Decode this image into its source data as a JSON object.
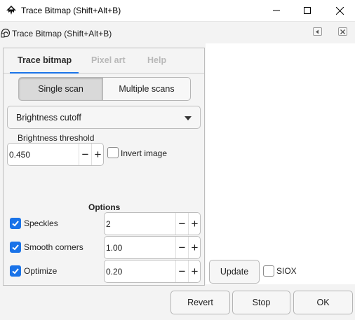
{
  "window": {
    "title": "Trace Bitmap (Shift+Alt+B)",
    "controls": {
      "minimize": "minimize-icon",
      "maximize": "maximize-icon",
      "close": "close-icon"
    }
  },
  "dialog": {
    "title": "Trace Bitmap (Shift+Alt+B)"
  },
  "tabs": [
    {
      "label": "Trace bitmap",
      "active": true
    },
    {
      "label": "Pixel art",
      "active": false
    },
    {
      "label": "Help",
      "active": false
    }
  ],
  "scan_mode": {
    "single_label": "Single scan",
    "multiple_label": "Multiple scans",
    "selected": "Single scan"
  },
  "mode_select": {
    "value": "Brightness cutoff"
  },
  "threshold": {
    "label": "Brightness threshold",
    "value": "0.450",
    "invert_label": "Invert image",
    "invert_checked": false
  },
  "options": {
    "heading": "Options",
    "items": [
      {
        "label": "Speckles",
        "checked": true,
        "value": "2"
      },
      {
        "label": "Smooth corners",
        "checked": true,
        "value": "1.00"
      },
      {
        "label": "Optimize",
        "checked": true,
        "value": "0.20"
      }
    ]
  },
  "preview": {
    "update_label": "Update",
    "siox_label": "SIOX",
    "siox_checked": false
  },
  "actions": {
    "revert_label": "Revert",
    "stop_label": "Stop",
    "ok_label": "OK"
  },
  "spin_symbols": {
    "minus": "−",
    "plus": "+"
  },
  "colors": {
    "accent": "#1a73e8",
    "panel": "#f4f4f4",
    "window_bg": "#f3f3f3"
  }
}
